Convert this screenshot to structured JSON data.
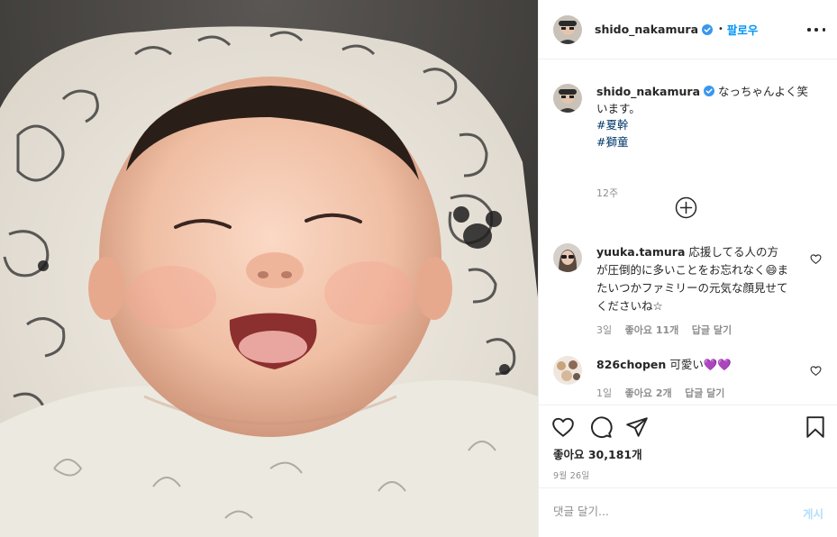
{
  "post": {
    "username": "shido_nakamura",
    "follow_label": "팔로우",
    "dot": "•",
    "caption_text": "なっちゃんよく笑います。",
    "hashtags": [
      "#夏幹",
      "#獅童"
    ],
    "caption_time": "12주",
    "likes_label": "좋아요 30,181개",
    "date": "9월 26일"
  },
  "comments": [
    {
      "username": "yuuka.tamura",
      "text": "応援してる人の方が圧倒的に多いことをお忘れなく😄またいつかファミリーの元気な顔見せてくださいね☆",
      "time": "3일",
      "likes": "좋아요 11개",
      "reply": "답글 달기"
    },
    {
      "username": "826chopen",
      "text": "可愛い💜💜",
      "time": "1일",
      "likes": "좋아요 2개",
      "reply": "답글 달기"
    }
  ],
  "add_comment": {
    "placeholder": "댓글 달기...",
    "post_label": "게시"
  },
  "colors": {
    "link": "#0095f6",
    "hashtag": "#00376b",
    "muted": "#8e8e8e",
    "verified": "#3897f0",
    "post_disabled": "#b2dffc"
  },
  "icons": [
    "more-options-icon",
    "verified-icon",
    "load-more-icon",
    "heart-icon",
    "comment-icon",
    "share-icon",
    "bookmark-icon"
  ]
}
